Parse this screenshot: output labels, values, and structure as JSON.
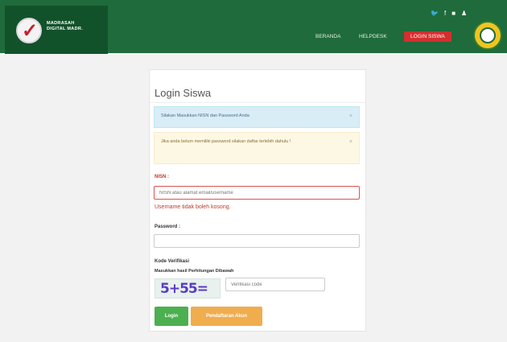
{
  "header": {
    "logo_text_line1": "MADRASAH",
    "logo_text_line2": "DIGITAL MADR.",
    "social_icons": [
      "twitter-icon",
      "facebook-icon",
      "instagram-icon",
      "user-icon"
    ],
    "social_glyphs": [
      "🐦",
      "f",
      "■",
      "♟"
    ],
    "nav": [
      {
        "label": "BERANDA"
      },
      {
        "label": "HELPDESK"
      }
    ],
    "nav_button": "LOGIN SISWA",
    "colors": {
      "bar": "#1f6b3b",
      "button": "#d32f2f"
    }
  },
  "login": {
    "title": "Login Siswa",
    "alert_info": "Silakan Masukkan NISN dan Password Anda",
    "alert_warning": "Jika anda belum memiliki password silakan daftar terlebih dahulu !",
    "alert_close": "×",
    "nisn_label": "NISN :",
    "nisn_placeholder": "NISN atau alamat email/username",
    "nisn_error": "Username tidak boleh kosong.",
    "password_label": "Password :",
    "password_placeholder": "",
    "verif_label": "Kode Verifikasi",
    "verif_sublabel": "Masukkan hasil Perhitungan Dibawah",
    "captcha_text": "5+55=",
    "verif_placeholder": "Verifikasi code",
    "login_button": "Login",
    "register_button": "Pendaftaran Akun"
  }
}
